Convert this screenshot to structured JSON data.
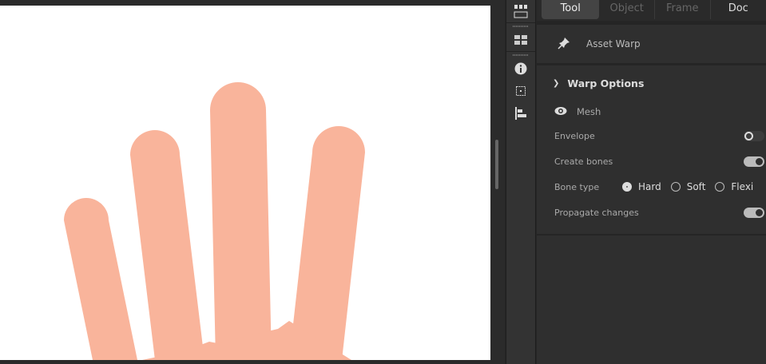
{
  "tabs": [
    "Tool",
    "Object",
    "Frame",
    "Doc"
  ],
  "asset_warp": "Asset Warp",
  "warp_options": {
    "title": "Warp Options",
    "mesh": "Mesh",
    "envelope": {
      "label": "Envelope",
      "on": false
    },
    "create_bones": {
      "label": "Create bones",
      "on": true
    },
    "bone_type": {
      "label": "Bone type",
      "options": [
        "Hard",
        "Soft",
        "Flexi"
      ],
      "selected": "Hard"
    },
    "propagate": {
      "label": "Propagate changes",
      "on": true
    }
  },
  "colors": {
    "hand": "#f9b49b"
  }
}
